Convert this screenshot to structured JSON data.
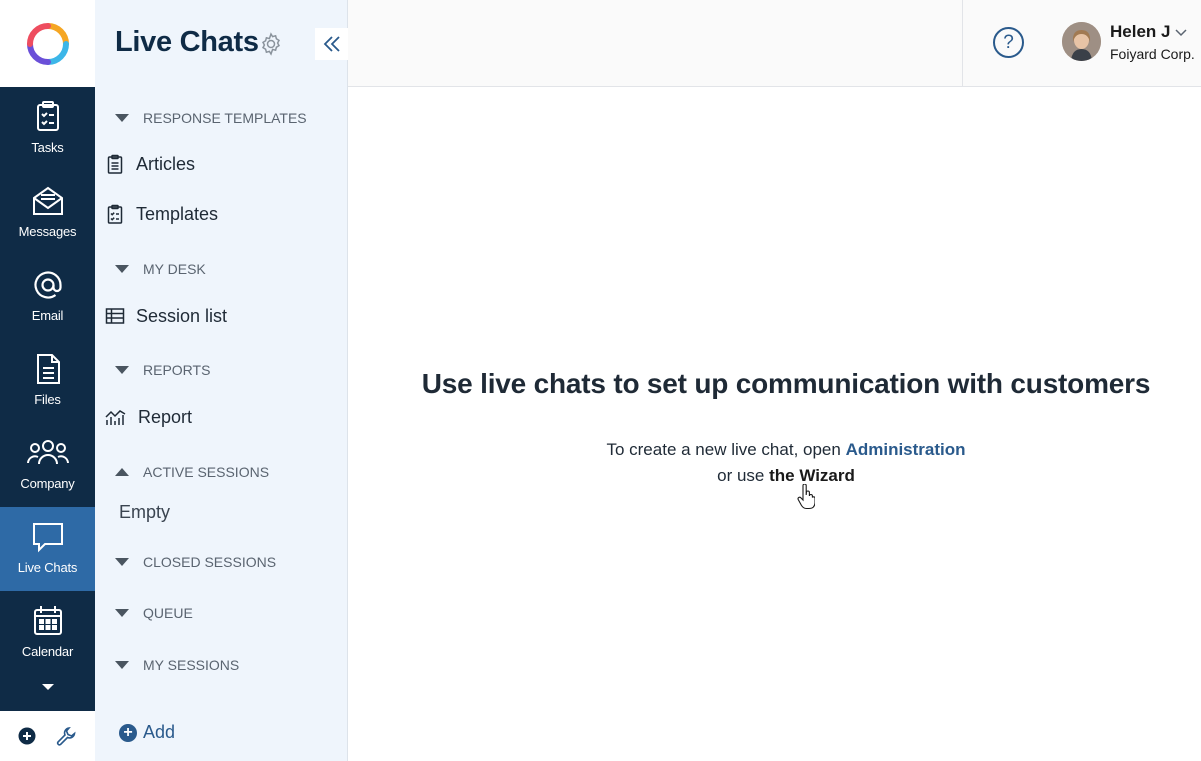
{
  "rail": {
    "items": [
      {
        "label": "Tasks",
        "icon": "clipboard-check-icon"
      },
      {
        "label": "Messages",
        "icon": "envelope-icon"
      },
      {
        "label": "Email",
        "icon": "at-sign-icon"
      },
      {
        "label": "Files",
        "icon": "document-icon"
      },
      {
        "label": "Company",
        "icon": "people-icon"
      },
      {
        "label": "Live Chats",
        "icon": "chat-bubble-icon",
        "active": true
      },
      {
        "label": "Calendar",
        "icon": "calendar-icon"
      }
    ]
  },
  "panel": {
    "title": "Live Chats",
    "sections": {
      "response_templates": "RESPONSE TEMPLATES",
      "my_desk": "MY DESK",
      "reports": "REPORTS",
      "active_sessions": "ACTIVE SESSIONS",
      "closed_sessions": "CLOSED SESSIONS",
      "queue": "QUEUE",
      "my_sessions": "MY SESSIONS"
    },
    "items": {
      "articles": "Articles",
      "templates": "Templates",
      "session_list": "Session list",
      "report": "Report"
    },
    "empty_text": "Empty",
    "add_label": "Add"
  },
  "header": {
    "help_label": "?",
    "user_name": "Helen J",
    "user_org": "Foiyard Corp."
  },
  "main": {
    "title": "Use live chats to set up communication with customers",
    "line1_prefix": "To create a new live chat, open ",
    "line1_link": "Administration",
    "line2_prefix": "or use ",
    "line2_link": "the Wizard"
  },
  "colors": {
    "rail_bg": "#0f2b46",
    "rail_active": "#2e6aa6",
    "panel_bg": "#eff5fc",
    "accent": "#2a5a8c"
  }
}
